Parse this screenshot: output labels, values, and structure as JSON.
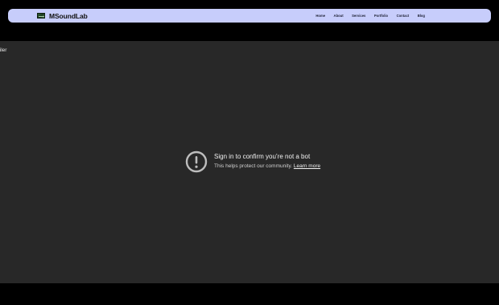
{
  "header": {
    "brand": "MSoundLab",
    "logo_icon": "studio-mixer-logo",
    "nav_items": [
      {
        "label": "Home"
      },
      {
        "label": "About"
      },
      {
        "label": "Services"
      },
      {
        "label": "Portfolio"
      },
      {
        "label": "Contact"
      },
      {
        "label": "Blog"
      }
    ]
  },
  "video": {
    "title_fragment": "railer",
    "notice": {
      "icon": "exclamation-circle-icon",
      "title": "Sign in to confirm you’re not a bot",
      "message": "This helps protect our community.",
      "link_label": "Learn more"
    }
  },
  "colors": {
    "page_background": "#000000",
    "navbar_background": "#c7cdfb",
    "player_background": "#282828",
    "notice_text": "#f1f1f1"
  }
}
